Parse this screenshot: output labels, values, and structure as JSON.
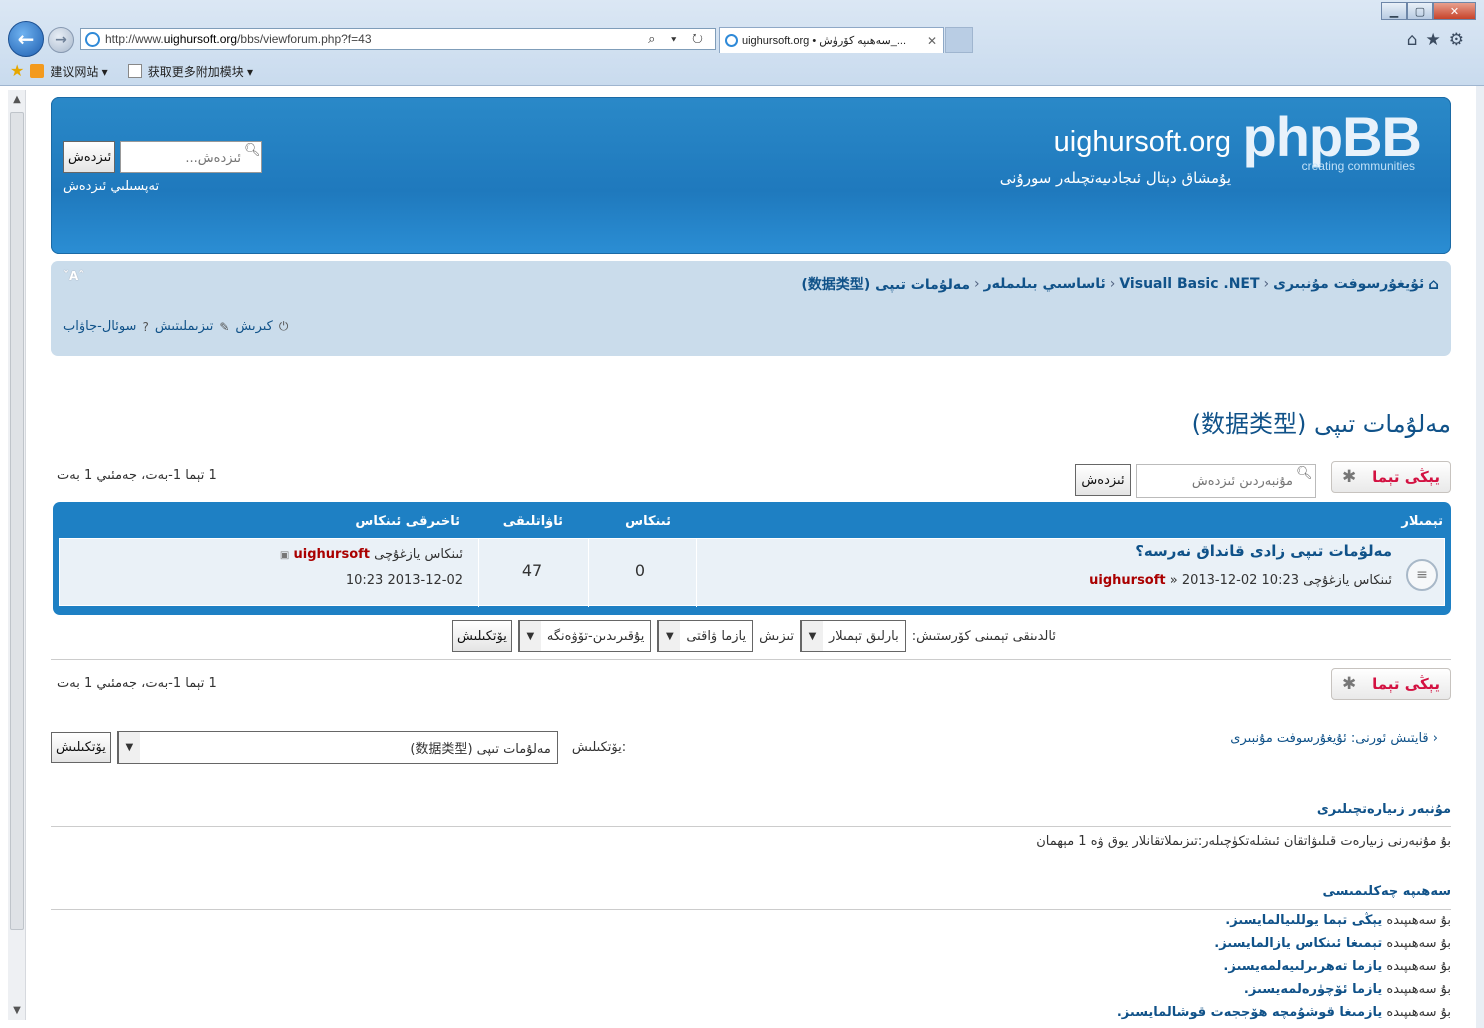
{
  "browser": {
    "url_prefix": "http://www.",
    "url_domain": "uighursoft.org",
    "url_path": "/bbs/viewforum.php?f=43",
    "address_tools": "⌕ ▾ ↻",
    "tab_title": "uighursoft.org • سەھىپە كۆرۈش_...",
    "favorites": {
      "suggested": "建议网站 ▾",
      "addons": "获取更多附加模块 ▾"
    }
  },
  "header": {
    "logo": "phpBB",
    "logo_tag": "creating   communities",
    "site_title": "uighursoft.org",
    "site_desc": "يۇمشاق دېتال ئىجادىيەتچىلەر سورۇنى",
    "search_placeholder": "ئىزدەش...",
    "search_button": "ئىزدەش",
    "advanced_search": "تەپسىلىي ئىزدەش"
  },
  "nav": {
    "breadcrumbs": [
      "ئۇيغۇرسوفت مۇنبىرى",
      "Visuall Basic .NET",
      "ئاساسىي بىلىملەر",
      "مەلۇمات تىپى (数据类型)"
    ],
    "font_size": "ˇAˆ",
    "links": {
      "login": "كىرىش",
      "register": "تىزىملىتىش",
      "faq": "سوئال-جاۋاب"
    }
  },
  "forum": {
    "title": "مەلۇمات تىپى (数据类型)",
    "new_topic": "يېڭى تېما",
    "search_placeholder": "مۇنبەردىن ئىزدەش",
    "search_button": "ئىزدەش",
    "pagination": "1 تېما   1-بەت، جەمئىي 1 بەت"
  },
  "table": {
    "headers": {
      "topics": "تېمىلار",
      "replies": "ئىنكاس",
      "views": "ئاۋاتلىقى",
      "last_post": "ئاخىرقى ئىنكاس"
    },
    "rows": [
      {
        "title": "مەلۇمات تىپى زادى قانداق نەرسە؟",
        "by_prefix": "ئىنكاس يازغۇچى",
        "author": "uighursoft",
        "posted": "2013-12-02 10:23",
        "replies": "0",
        "views": "47",
        "last_by": "ئىنكاس يازغۇچى",
        "last_author": "uighursoft",
        "last_time": "2013-12-02 10:23"
      }
    ]
  },
  "sort": {
    "label": "ئالدىنقى تېمىنى كۆرستىش:",
    "days": "بارلىق تېمىلار",
    "sort_label": "تىزىش",
    "key": "يازما ۋاقتى",
    "dir": "يۇقىرىدىن-تۆۋەنگە",
    "go": "يۆتكىلىش"
  },
  "jump": {
    "return_text": "قايتىش ئورنى: ئۇيغۇرسوفت مۇنبىرى",
    "label": "يۆتكىلىش:",
    "value": "مەلۇمات تىپى (数据类型)",
    "go": "يۆتكىلىش"
  },
  "online": {
    "heading": "مۇنبەر زىيارەتچىلىرى",
    "text": "بۇ مۇنبەرنى زىيارەت قىلىۋاتقان ئىشلەتكۈچىلەر:تىزىملاتقانلار يوق ۋە 1 مېھمان"
  },
  "permissions": {
    "heading": "سەھىپە چەكلىمىسى",
    "lines": [
      [
        "بۇ سەھىپىدە ",
        "يېڭى تېما يوللىيالمايسىز."
      ],
      [
        "بۇ سەھىپىدە ",
        "تېمىغا ئىنكاس يازالمايسىز."
      ],
      [
        "بۇ سەھىپىدە ",
        "يازما تەھرىرلىيەلمەيسىز."
      ],
      [
        "بۇ سەھىپىدە ",
        "يازما ئۆچۈرەلمەيسىز."
      ],
      [
        "بۇ سەھىپىدە ",
        "يازمىغا قوشۇمچە ھۆججەت قوشالمايسىز."
      ]
    ]
  }
}
